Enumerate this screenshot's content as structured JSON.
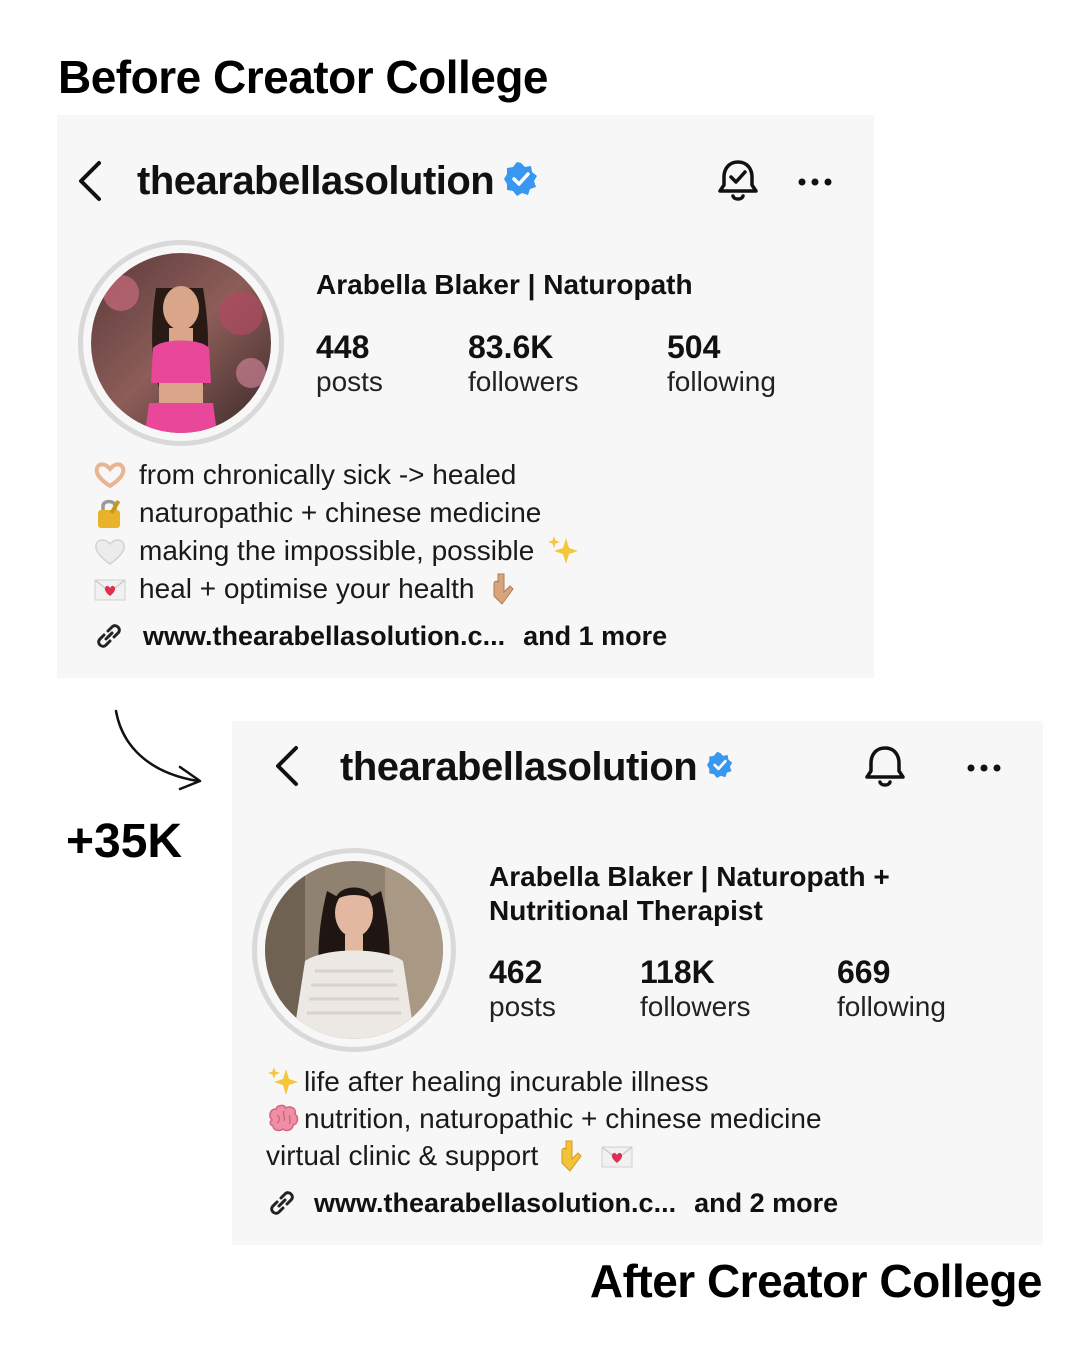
{
  "headings": {
    "before": "Before Creator College",
    "after": "After Creator College"
  },
  "growth_label": "+35K",
  "before": {
    "username": "thearabellasolution",
    "display_name": "Arabella Blaker | Naturopath",
    "stats": [
      {
        "value": "448",
        "label": "posts"
      },
      {
        "value": "83.6K",
        "label": "followers"
      },
      {
        "value": "504",
        "label": "following"
      }
    ],
    "bio": [
      {
        "icon": "heart-hands-icon",
        "text": "from chronically sick -> healed"
      },
      {
        "icon": "lock-key-icon",
        "text": "naturopathic + chinese medicine"
      },
      {
        "icon": "white-heart-icon",
        "text": "making the impossible, possible",
        "trailing_icon": "sparkles-icon"
      },
      {
        "icon": "love-letter-icon",
        "text": "heal + optimise your health",
        "trailing_icon": "pointing-down-icon"
      }
    ],
    "link": "www.thearabellasolution.c...",
    "link_more": "and 1 more"
  },
  "after": {
    "username": "thearabellasolution",
    "display_name_line1": "Arabella Blaker | Naturopath +",
    "display_name_line2": "Nutritional Therapist",
    "stats": [
      {
        "value": "462",
        "label": "posts"
      },
      {
        "value": "118K",
        "label": "followers"
      },
      {
        "value": "669",
        "label": "following"
      }
    ],
    "bio": [
      {
        "icon": "sparkles-icon",
        "text": "life after healing incurable illness"
      },
      {
        "icon": "brain-icon",
        "text": "nutrition, naturopathic + chinese medicine"
      },
      {
        "text": "virtual clinic & support",
        "trailing_icons": [
          "pointing-down-icon",
          "love-letter-icon"
        ]
      }
    ],
    "link": "www.thearabellasolution.c...",
    "link_more": "and 2 more"
  },
  "colors": {
    "verified": "#3897f0",
    "card_bg": "#f7f7f7",
    "text": "#111111"
  }
}
